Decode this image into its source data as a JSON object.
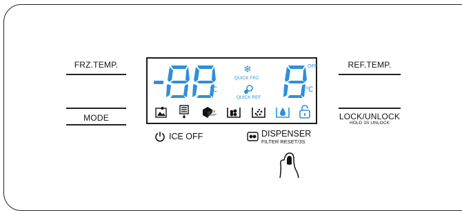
{
  "buttons": {
    "frz_temp": "FRZ.TEMP.",
    "mode": "MODE",
    "ref_temp": "REF.TEMP.",
    "lock_unlock": "LOCK/UNLOCK",
    "lock_hint": "HOLD 3S UNLOCK"
  },
  "display": {
    "freezer_digits": "-88",
    "freezer_unit": "℃",
    "fridge_digit": "8",
    "fridge_unit": "℃",
    "off_label": "OFF",
    "quick_frz": "QUICK FRZ.",
    "quick_ref": "QUICK REF",
    "ice_off_label_top": "ICE",
    "ice_off_label_bottom": "OFF"
  },
  "bottom": {
    "ice_off": "ICE OFF",
    "dispenser": "DISPENSER",
    "filter_reset": "FILTER RESET/3S"
  },
  "colors": {
    "lcd_blue": "#2f8fd9",
    "outline": "#222222"
  },
  "icons": [
    "photo-icon",
    "water-cup-icon",
    "ice-cube-icon",
    "cubed-ice-icon",
    "crushed-ice-icon",
    "water-filter-icon",
    "lock-open-icon",
    "power-icon",
    "dispenser-icon",
    "finger-touch-icon"
  ]
}
